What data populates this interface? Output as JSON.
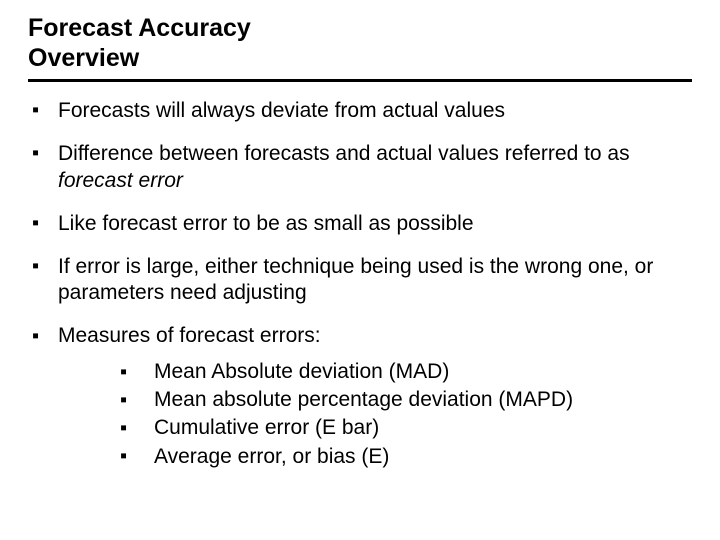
{
  "title": {
    "line1": "Forecast Accuracy",
    "line2": "Overview"
  },
  "bullets": [
    {
      "html": "Forecasts will always deviate from actual values"
    },
    {
      "html": "Difference between forecasts and actual values referred to as <span class=\"italic\">forecast error</span>"
    },
    {
      "html": "Like forecast error to be as small as possible"
    },
    {
      "html": "If error is large, either technique being used is the wrong one, or parameters need adjusting"
    },
    {
      "html": "Measures of forecast errors:",
      "sub": [
        {
          "text": "Mean Absolute deviation (MAD)"
        },
        {
          "text": "Mean absolute percentage deviation (MAPD)"
        },
        {
          "text": "Cumulative error (E bar)"
        },
        {
          "text": "Average error, or  bias (E)"
        }
      ]
    }
  ]
}
